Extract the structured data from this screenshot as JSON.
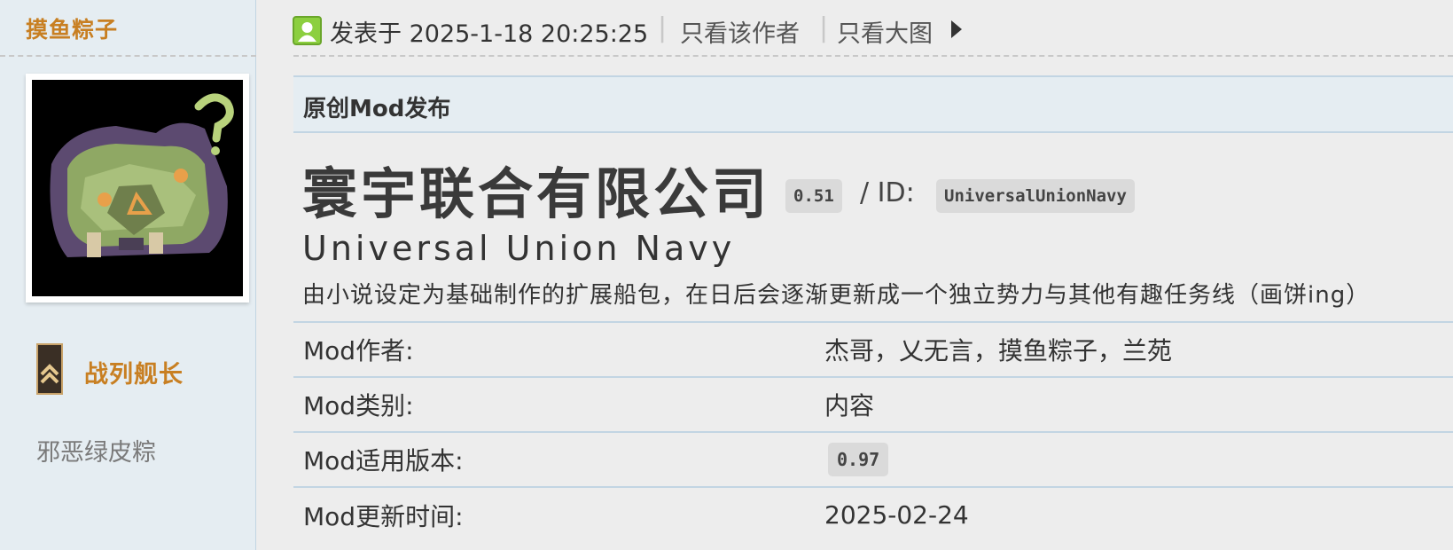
{
  "author": {
    "name": "摸鱼粽子",
    "rank_title": "战列舰长",
    "user_title": "邪恶绿皮粽"
  },
  "post_header": {
    "posted_at": "发表于 2025-1-18 20:25:25",
    "separator": "|",
    "only_author": "只看该作者",
    "only_images": "只看大图"
  },
  "category": "原创Mod发布",
  "mod": {
    "title": "寰宇联合有限公司",
    "version": "0.51",
    "id_label": "/ ID:",
    "id": "UniversalUnionNavy",
    "subtitle": "Universal Union Navy",
    "description": "由小说设定为基础制作的扩展船包，在日后会逐渐更新成一个独立势力与其他有趣任务线（画饼ing）"
  },
  "meta_rows": [
    {
      "label": "Mod作者:",
      "value": "杰哥，乂无言，摸鱼粽子，兰苑"
    },
    {
      "label": "Mod类别:",
      "value": "内容"
    },
    {
      "label": "Mod适用版本:",
      "value": "0.97"
    },
    {
      "label": "Mod更新时间:",
      "value": "2025-02-24"
    }
  ],
  "icons": {
    "online": "user-online-icon",
    "arrow": "caret-right-icon",
    "rank": "rank-chevron-icon"
  },
  "colors": {
    "accent_orange": "#c87f22",
    "panel_blue": "#e5edf2",
    "border_blue": "#c2d5e3",
    "pill_gray": "#dadada"
  }
}
